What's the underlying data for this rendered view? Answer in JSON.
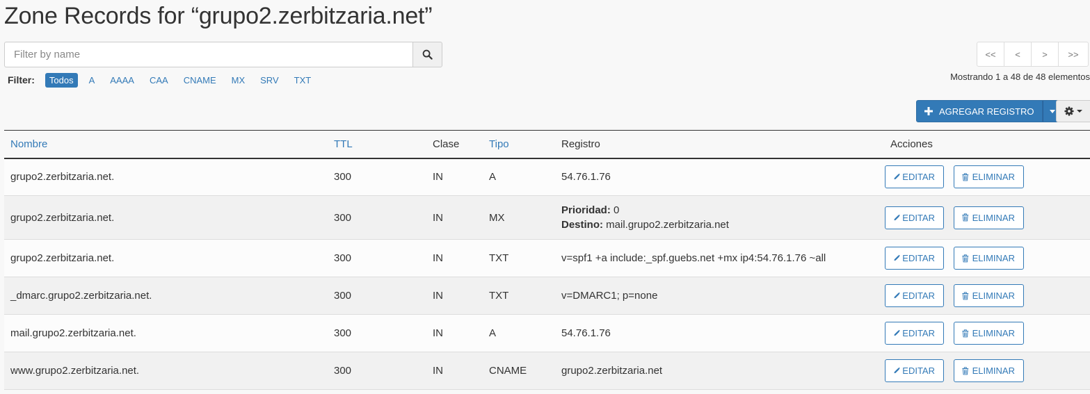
{
  "page": {
    "title": "Zone Records for “grupo2.zerbitzaria.net”"
  },
  "search": {
    "placeholder": "Filter by name",
    "value": ""
  },
  "filter": {
    "label": "Filter:",
    "items": [
      "Todos",
      "A",
      "AAAA",
      "CAA",
      "CNAME",
      "MX",
      "SRV",
      "TXT"
    ],
    "active": "Todos"
  },
  "pager": {
    "buttons": [
      "<<",
      "<",
      ">",
      ">>"
    ],
    "info": "Mostrando 1 a 48 de 48 elementos"
  },
  "toolbar": {
    "add_label": "AGREGAR REGISTRO"
  },
  "table": {
    "headers": [
      "Nombre",
      "TTL",
      "Clase",
      "Tipo",
      "Registro",
      "Acciones"
    ],
    "edit_label": "EDITAR",
    "delete_label": "ELIMINAR",
    "rows": [
      {
        "name": "grupo2.zerbitzaria.net.",
        "ttl": "300",
        "class": "IN",
        "type": "A",
        "record": [
          {
            "text": "54.76.1.76"
          }
        ]
      },
      {
        "name": "grupo2.zerbitzaria.net.",
        "ttl": "300",
        "class": "IN",
        "type": "MX",
        "record": [
          {
            "label": "Prioridad:",
            "text": "0"
          },
          {
            "label": "Destino:",
            "text": "mail.grupo2.zerbitzaria.net"
          }
        ]
      },
      {
        "name": "grupo2.zerbitzaria.net.",
        "ttl": "300",
        "class": "IN",
        "type": "TXT",
        "record": [
          {
            "text": "v=spf1 +a include:_spf.guebs.net +mx ip4:54.76.1.76 ~all"
          }
        ]
      },
      {
        "name": "_dmarc.grupo2.zerbitzaria.net.",
        "ttl": "300",
        "class": "IN",
        "type": "TXT",
        "record": [
          {
            "text": "v=DMARC1; p=none"
          }
        ]
      },
      {
        "name": "mail.grupo2.zerbitzaria.net.",
        "ttl": "300",
        "class": "IN",
        "type": "A",
        "record": [
          {
            "text": "54.76.1.76"
          }
        ]
      },
      {
        "name": "www.grupo2.zerbitzaria.net.",
        "ttl": "300",
        "class": "IN",
        "type": "CNAME",
        "record": [
          {
            "text": "grupo2.zerbitzaria.net"
          }
        ]
      }
    ]
  },
  "icons": {
    "search": "search-icon",
    "plus": "plus-icon",
    "gear": "gear-icon",
    "edit": "pencil-icon",
    "delete": "trash-icon"
  },
  "colors": {
    "accent": "#337ab7",
    "text": "#333333",
    "background": "#f8f8f8"
  }
}
